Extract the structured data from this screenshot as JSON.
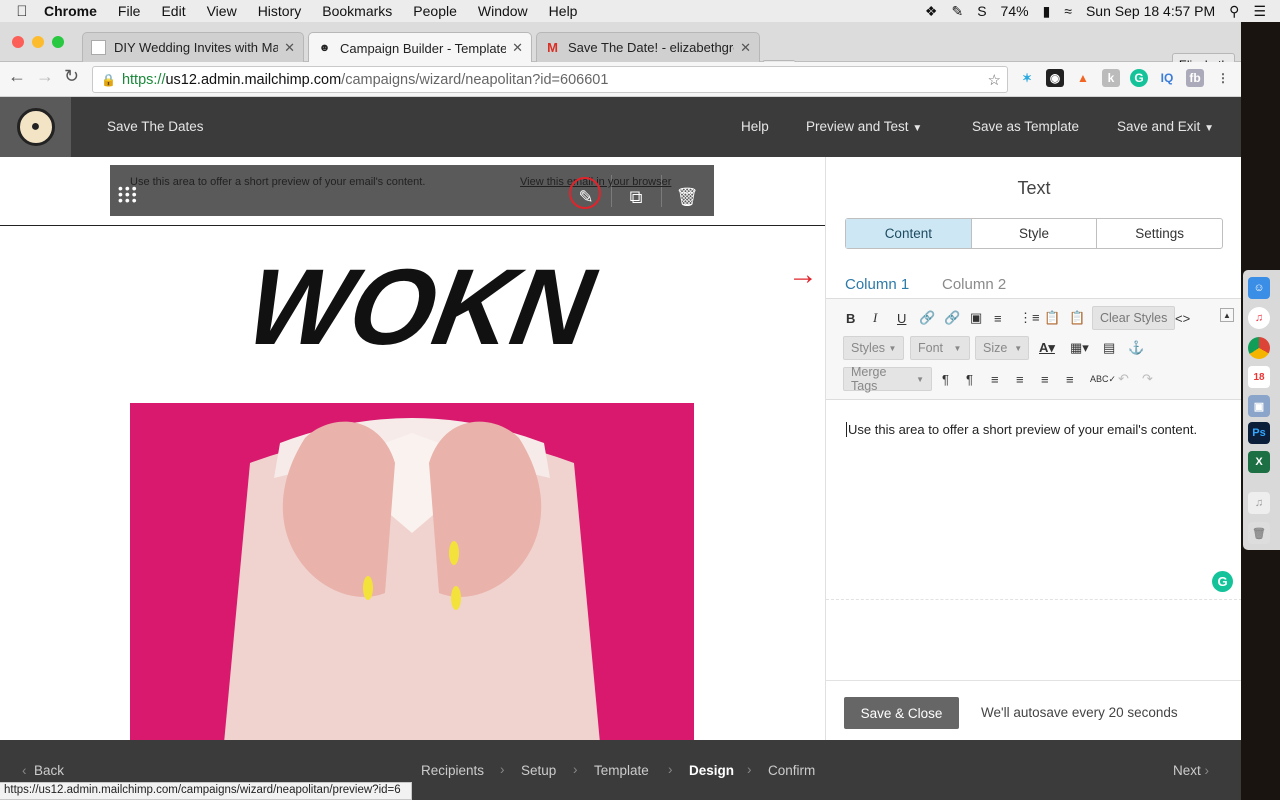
{
  "menubar": {
    "app": "Chrome",
    "items": [
      "File",
      "Edit",
      "View",
      "History",
      "Bookmarks",
      "People",
      "Window",
      "Help"
    ],
    "battery": "74%",
    "clock": "Sun Sep 18  4:57 PM"
  },
  "browser": {
    "tabs": [
      {
        "title": "DIY Wedding Invites with Mailc",
        "active": false
      },
      {
        "title": "Campaign Builder - Template D",
        "active": true
      },
      {
        "title": "Save The Date! - elizabethgree",
        "active": false
      }
    ],
    "profile": "Elizabeth",
    "url": {
      "scheme": "https://",
      "host": "us12.admin.mailchimp.com",
      "path": "/campaigns/wizard/neapolitan?id=606601"
    },
    "status_url": "https://us12.admin.mailchimp.com/campaigns/wizard/neapolitan/preview?id=6"
  },
  "header": {
    "campaign_name": "Save The Dates",
    "help": "Help",
    "preview": "Preview and Test",
    "save_template": "Save as Template",
    "save_exit": "Save and Exit"
  },
  "canvas": {
    "preheader_text": "Use this area to offer a short preview of your email's content.",
    "view_in_browser": "View this email in your browser",
    "logo_text": "WOKN"
  },
  "panel": {
    "title": "Text",
    "tabs": [
      "Content",
      "Style",
      "Settings"
    ],
    "columns": [
      "Column 1",
      "Column 2"
    ],
    "toolbar": {
      "clear_styles": "Clear Styles",
      "styles": "Styles",
      "font": "Font",
      "size": "Size",
      "merge_tags": "Merge Tags"
    },
    "editor_text": "Use this area to offer a short preview of your email's content.",
    "save_close": "Save & Close",
    "autosave": "We'll autosave every 20 seconds"
  },
  "footer": {
    "back": "Back",
    "steps": [
      "Recipients",
      "Setup",
      "Template",
      "Design",
      "Confirm"
    ],
    "current_step": "Design",
    "next": "Next"
  },
  "colors": {
    "header_bg": "#3b3b3b",
    "tab_active": "#cde8f4",
    "annotation_red": "#e0242b",
    "photo_pink": "#d8196e"
  }
}
